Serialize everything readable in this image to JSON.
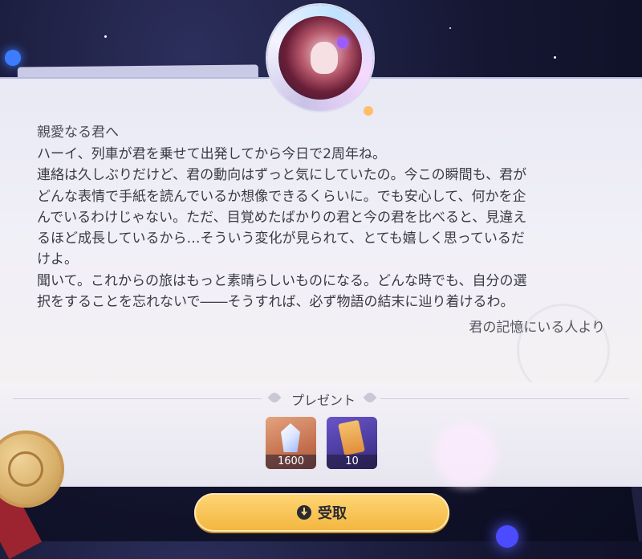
{
  "letter": {
    "salutation": "親愛なる君へ",
    "body": "ハーイ、列車が君を乗せて出発してから今日で2周年ね。\n連絡は久しぶりだけど、君の動向はずっと気にしていたの。今この瞬間も、君が\nどんな表情で手紙を読んでいるか想像できるくらいに。でも安心して、何かを企\nんでいるわけじゃない。ただ、目覚めたばかりの君と今の君を比べると、見違え\nるほど成長しているから…そういう変化が見られて、とても嬉しく思っているだ\nけよ。\n聞いて。これからの旅はもっと素晴らしいものになる。どんな時でも、自分の選\n択をすることを忘れないで――そうすれば、必ず物語の結末に辿り着けるわ。",
    "signature": "君の記憶にいる人より"
  },
  "gifts": {
    "title": "プレゼント",
    "items": [
      {
        "icon": "crystal-icon",
        "count": "1600"
      },
      {
        "icon": "ticket-icon",
        "count": "10"
      }
    ]
  },
  "claim_button": {
    "label": "受取",
    "icon": "download-icon"
  },
  "colors": {
    "button": "#f2b63d",
    "background": "#151733",
    "paper": "#eeeef6"
  }
}
